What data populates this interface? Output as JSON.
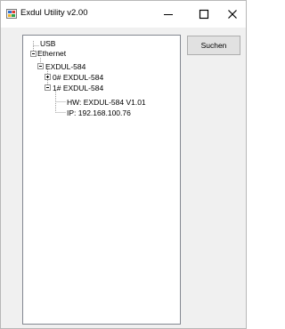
{
  "window": {
    "title": "Exdul Utility v2.00"
  },
  "toolbar": {
    "search_label": "Suchen"
  },
  "tree": {
    "usb": "USB",
    "ethernet": "Ethernet",
    "exdul": "EXDUL-584",
    "device0": "0# EXDUL-584",
    "device1": "1# EXDUL-584",
    "hw": "HW: EXDUL-584  V1.01",
    "ip": "IP: 192.168.100.76"
  },
  "icons": {
    "app": "app-icon",
    "minimize": "minimize-icon",
    "maximize": "maximize-icon",
    "close": "close-icon"
  }
}
